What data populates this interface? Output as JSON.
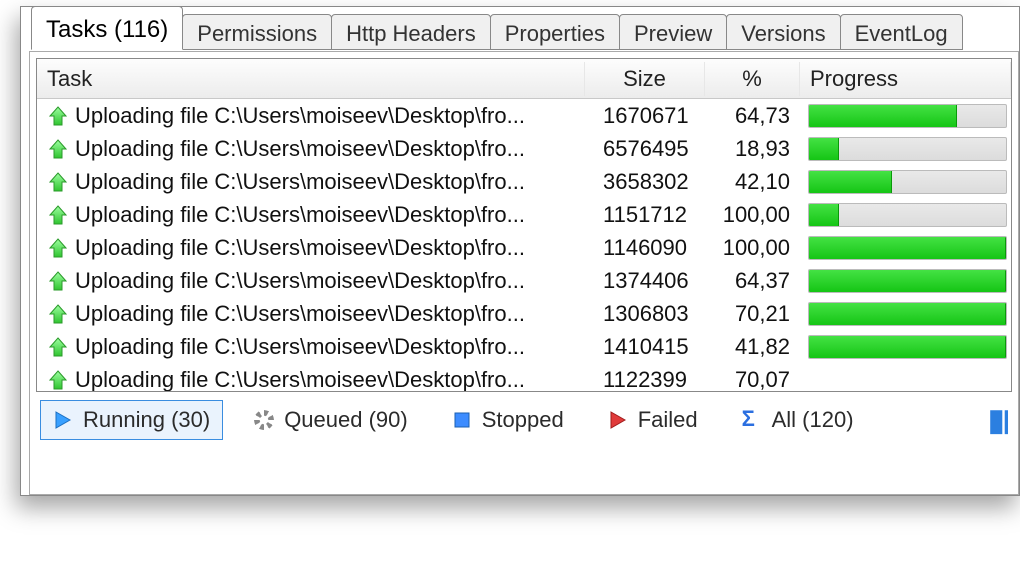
{
  "tabs": [
    {
      "label": "Tasks (116)",
      "active": true
    },
    {
      "label": "Permissions"
    },
    {
      "label": "Http Headers"
    },
    {
      "label": "Properties"
    },
    {
      "label": "Preview"
    },
    {
      "label": "Versions"
    },
    {
      "label": "EventLog"
    }
  ],
  "columns": {
    "task": "Task",
    "size": "Size",
    "percent": "%",
    "progress": "Progress"
  },
  "rows": [
    {
      "task": "Uploading file C:\\Users\\moiseev\\Desktop\\fro...",
      "size": "1670671",
      "pct": "64,73",
      "bar": 75
    },
    {
      "task": "Uploading file C:\\Users\\moiseev\\Desktop\\fro...",
      "size": "6576495",
      "pct": "18,93",
      "bar": 15
    },
    {
      "task": "Uploading file C:\\Users\\moiseev\\Desktop\\fro...",
      "size": "3658302",
      "pct": "42,10",
      "bar": 42
    },
    {
      "task": "Uploading file C:\\Users\\moiseev\\Desktop\\fro...",
      "size": "1151712",
      "pct": "100,00",
      "bar": 15
    },
    {
      "task": "Uploading file C:\\Users\\moiseev\\Desktop\\fro...",
      "size": "1146090",
      "pct": "100,00",
      "bar": 100
    },
    {
      "task": "Uploading file C:\\Users\\moiseev\\Desktop\\fro...",
      "size": "1374406",
      "pct": "64,37",
      "bar": 100
    },
    {
      "task": "Uploading file C:\\Users\\moiseev\\Desktop\\fro...",
      "size": "1306803",
      "pct": "70,21",
      "bar": 100
    },
    {
      "task": "Uploading file C:\\Users\\moiseev\\Desktop\\fro...",
      "size": "1410415",
      "pct": "41,82",
      "bar": 100
    },
    {
      "task": "Uploading file C:\\Users\\moiseev\\Desktop\\fro...",
      "size": "1122399",
      "pct": "70,07",
      "bar": 0
    }
  ],
  "filters": {
    "running": "Running (30)",
    "queued": "Queued (90)",
    "stopped": "Stopped",
    "failed": "Failed",
    "all": "All (120)"
  },
  "sigma": "Σ"
}
